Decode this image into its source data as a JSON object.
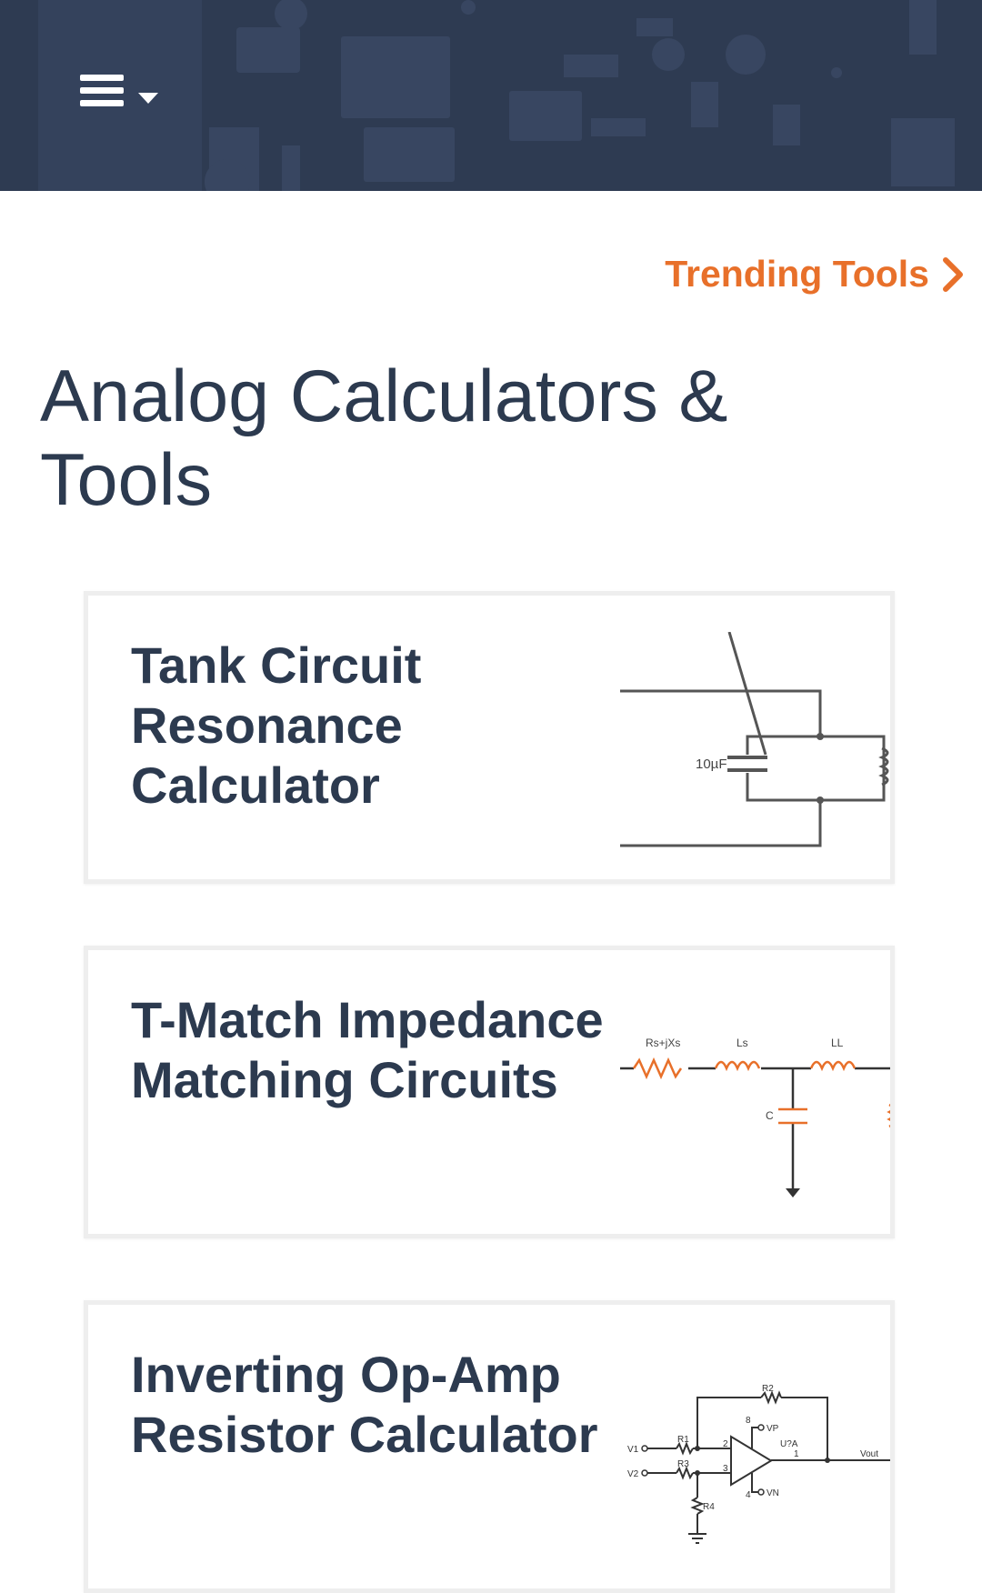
{
  "header": {
    "menu_icon": "hamburger-menu-icon",
    "dropdown_icon": "caret-down-icon",
    "background_color": "#2e3b52"
  },
  "trending": {
    "label": "Trending Tools",
    "icon": "chevron-right-icon",
    "color": "#e8702a"
  },
  "page": {
    "title": "Analog Calculators & Tools"
  },
  "cards": [
    {
      "title": "Tank Circuit Resonance Calculator",
      "image": {
        "icon": "tank-circuit-schematic",
        "labels": [
          "10µF"
        ]
      }
    },
    {
      "title": "T-Match Impedance Matching Circuits",
      "image": {
        "icon": "t-match-schematic",
        "labels": [
          "Rs+jXs",
          "Ls",
          "LL",
          "C"
        ]
      }
    },
    {
      "title": "Inverting Op-Amp Resistor Calculator",
      "image": {
        "icon": "inverting-opamp-schematic",
        "labels": [
          "R2",
          "R1",
          "R3",
          "R4",
          "V1",
          "V2",
          "VP",
          "VN",
          "U?A",
          "Vout",
          "8",
          "2",
          "3",
          "4",
          "1"
        ]
      }
    }
  ]
}
